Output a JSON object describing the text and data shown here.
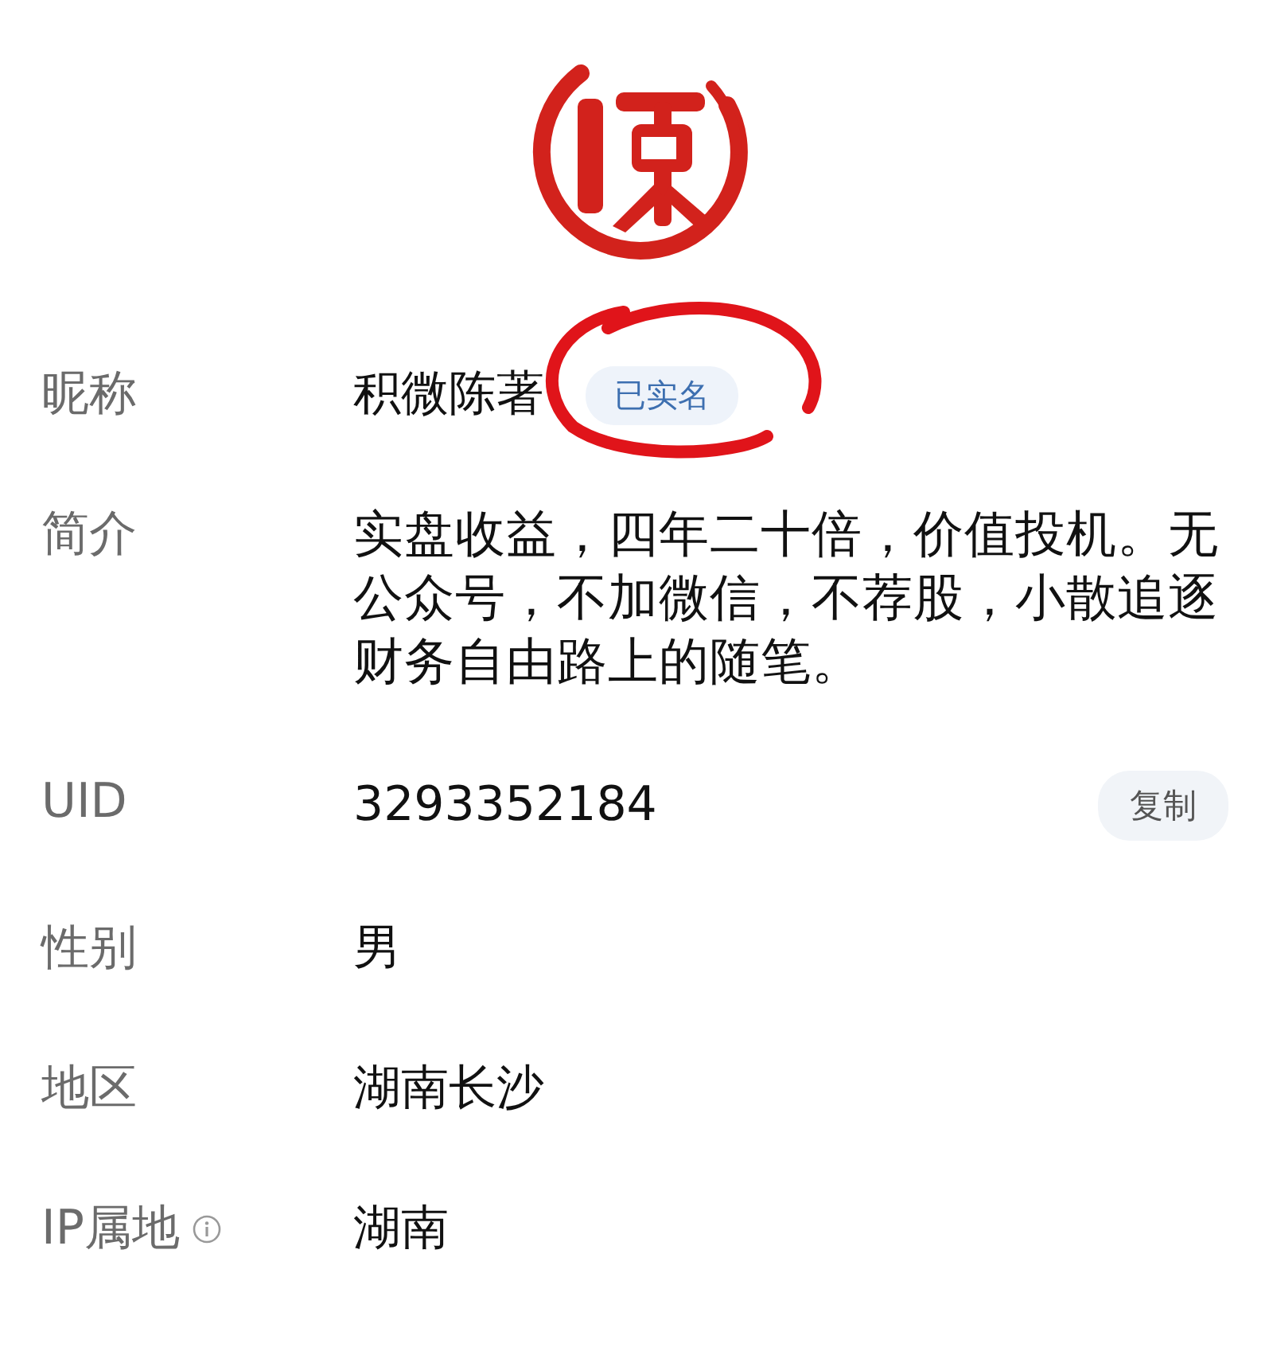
{
  "fields": [
    {
      "kind": "badge",
      "label": "昵称",
      "value": "积微陈著",
      "badge": "已实名",
      "circled": true
    },
    {
      "kind": "text",
      "label": "简介",
      "value": "实盘收益，四年二十倍，价值投机。无公众号，不加微信，不荐股，小散追逐财务自由路上的随笔。"
    },
    {
      "kind": "copy",
      "label": "UID",
      "value": "3293352184",
      "button": "复制"
    },
    {
      "kind": "text",
      "label": "性别",
      "value": "男"
    },
    {
      "kind": "text",
      "label": "地区",
      "value": "湖南长沙"
    },
    {
      "kind": "info",
      "label": "IP属地",
      "value": "湖南"
    }
  ]
}
